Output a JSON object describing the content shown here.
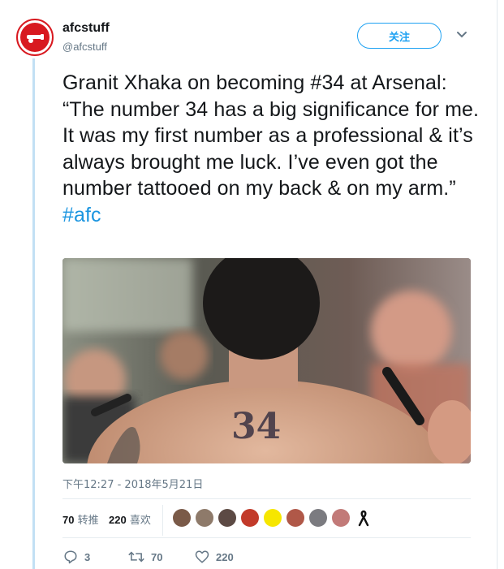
{
  "tweet": {
    "user": {
      "display_name": "afcstuff",
      "handle": "@afcstuff",
      "brand_color": "#d81920"
    },
    "follow_label": "关注",
    "text_main": "Granit Xhaka on becoming #34 at Arsenal: “The number 34 has a big significance for me. It was my first number as a professional & it’s always brought me luck. I’ve even got the number tattooed on my back & on my arm.” ",
    "hashtag": "#afc",
    "photo_tattoo_text": "34",
    "timestamp": "下午12:27 - 2018年5月21日",
    "stats": {
      "retweets_count": "70",
      "retweets_label": "转推",
      "likes_count": "220",
      "likes_label": "喜欢"
    },
    "liker_colors": [
      "#7a5a48",
      "#8e7a6a",
      "#5c4a44",
      "#c23a2a",
      "#f6e600",
      "#b05848",
      "#7b7b80",
      "#c27a78",
      "#222222"
    ],
    "actions": {
      "reply_count": "3",
      "retweet_count": "70",
      "like_count": "220"
    },
    "link_color": "#1b95e0"
  }
}
